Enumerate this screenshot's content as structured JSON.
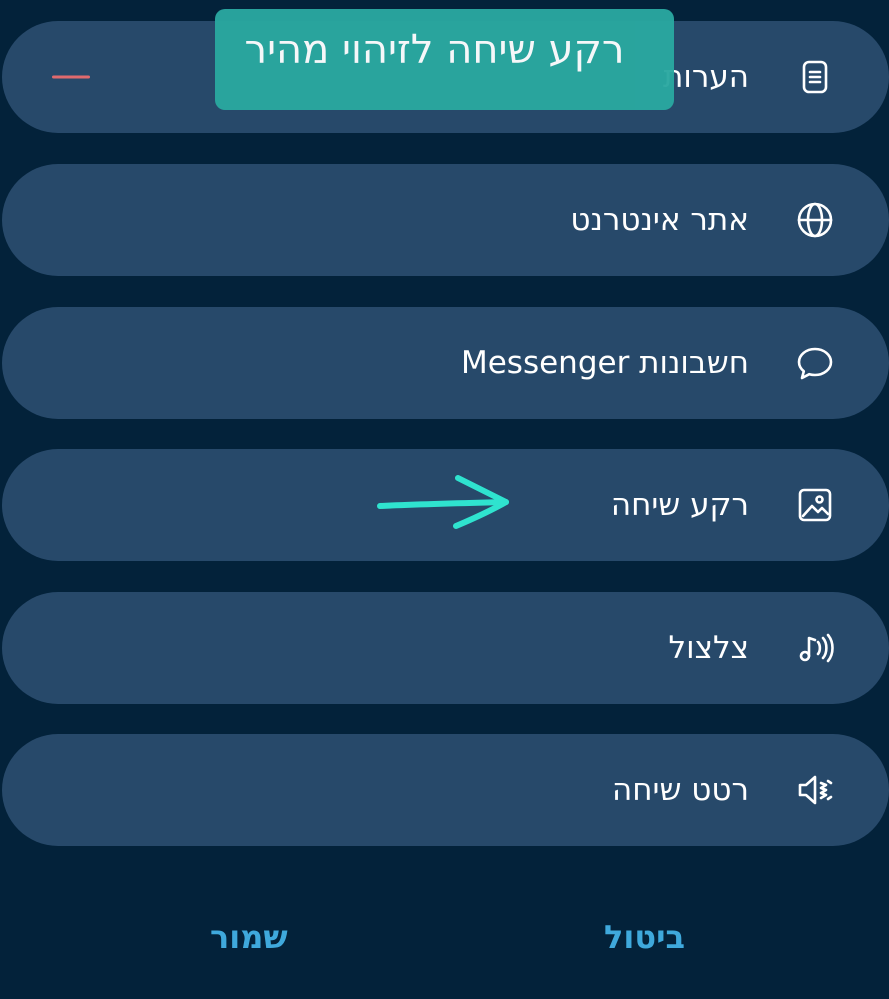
{
  "rows": [
    {
      "label": "הערות",
      "icon": "notes-icon"
    },
    {
      "label": "אתר אינטרנט",
      "icon": "globe-icon"
    },
    {
      "label": "חשבונות Messenger",
      "icon": "chat-bubble-icon"
    },
    {
      "label": "רקע שיחה",
      "icon": "image-icon"
    },
    {
      "label": "צלצול",
      "icon": "ringtone-icon"
    },
    {
      "label": "רטט שיחה",
      "icon": "vibration-off-icon"
    }
  ],
  "tooltip": {
    "text": "רקע שיחה לזיהוי מהיר"
  },
  "buttons": {
    "save_label": "שמור",
    "cancel_label": "ביטול"
  },
  "colors": {
    "background": "#03223a",
    "row": "#27496a",
    "accent": "#3fa9dc",
    "tooltip": "#2aa8a0",
    "arrow": "#2fe3cf",
    "remove": "#e06a6e"
  }
}
